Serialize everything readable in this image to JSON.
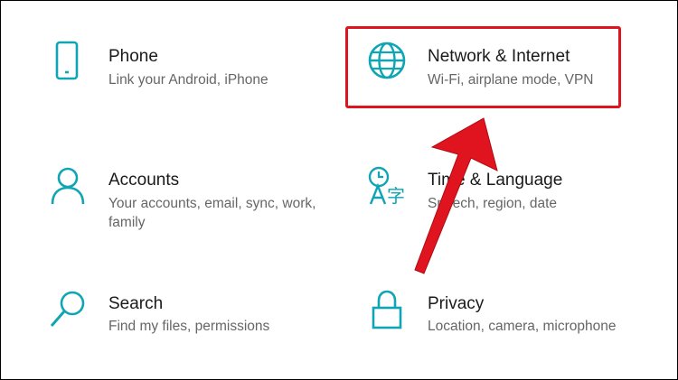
{
  "tiles": [
    {
      "id": "phone",
      "title": "Phone",
      "desc": "Link your Android, iPhone",
      "icon": "phone-icon"
    },
    {
      "id": "network",
      "title": "Network & Internet",
      "desc": "Wi-Fi, airplane mode, VPN",
      "icon": "globe-icon"
    },
    {
      "id": "accounts",
      "title": "Accounts",
      "desc": "Your accounts, email, sync, work, family",
      "icon": "person-icon"
    },
    {
      "id": "time",
      "title": "Time & Language",
      "desc": "Speech, region, date",
      "icon": "time-language-icon"
    },
    {
      "id": "search",
      "title": "Search",
      "desc": "Find my files, permissions",
      "icon": "magnifier-icon"
    },
    {
      "id": "privacy",
      "title": "Privacy",
      "desc": "Location, camera, microphone",
      "icon": "lock-icon"
    }
  ],
  "colors": {
    "accent": "#0fa5b5",
    "annotation": "#e0141e",
    "title_text": "#1a1a1a",
    "desc_text": "#666666"
  },
  "annotation": {
    "highlighted_tile": "network"
  }
}
